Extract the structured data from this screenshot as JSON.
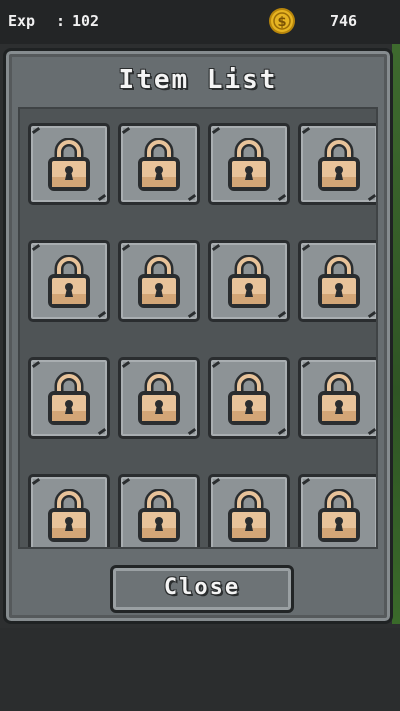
{
  "hud": {
    "exp_label": "Exp",
    "exp_sep": ":",
    "exp_value": "102",
    "coin_icon": "dollar-coin-icon",
    "coin_value": "746"
  },
  "panel": {
    "title": "Item List",
    "close_label": "Close"
  },
  "slots": {
    "count": 16,
    "state": "locked",
    "icon": "padlock-icon"
  },
  "colors": {
    "panel": "#676d70",
    "slot": "#8d9396",
    "lock_body": "#e8c39a",
    "coin": "#d9a520"
  }
}
